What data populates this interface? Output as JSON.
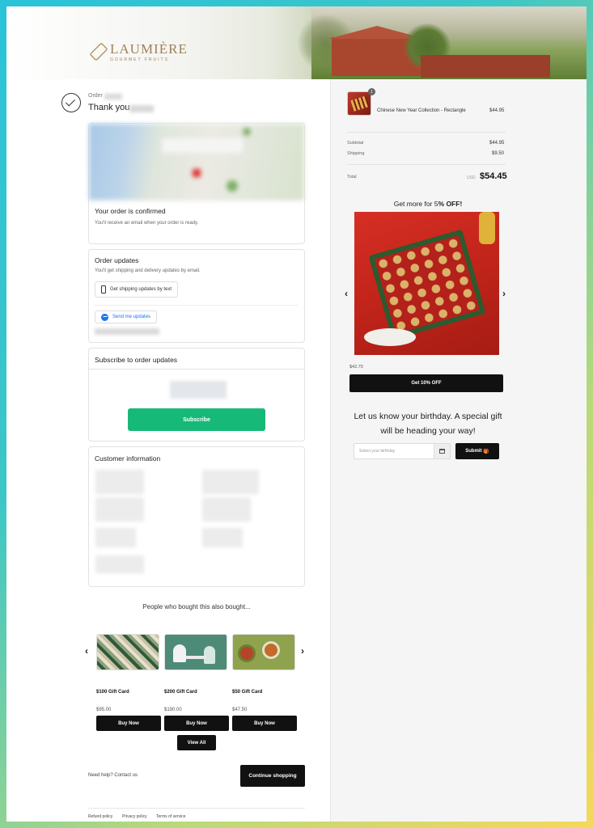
{
  "brand": {
    "name": "LAUMIÈRE",
    "tagline": "GOURMET FRUITS"
  },
  "colors": {
    "accent_green": "#17b978",
    "dark": "#111111",
    "brand_gold": "#9c8258"
  },
  "order": {
    "label": "Order",
    "thank_you": "Thank you"
  },
  "confirmed_card": {
    "title": "Your order is confirmed",
    "subtitle": "You'll receive an email when your order is ready."
  },
  "updates_card": {
    "title": "Order updates",
    "subtitle": "You'll get shipping and delivery updates by email.",
    "text_button": "Get shipping updates by text",
    "messenger_button": "Send me updates"
  },
  "subscribe_card": {
    "title": "Subscribe to order updates",
    "button": "Subscribe"
  },
  "customer_card": {
    "title": "Customer information"
  },
  "recommendations": {
    "title": "People who bought this also bought...",
    "items": [
      {
        "name": "$100 Gift Card",
        "price": "$95.00",
        "button": "Buy Now"
      },
      {
        "name": "$200 Gift Card",
        "price": "$190.00",
        "button": "Buy Now"
      },
      {
        "name": "$50 Gift Card",
        "price": "$47.50",
        "button": "Buy Now"
      }
    ],
    "view_all": "View All"
  },
  "footer": {
    "need_help": "Need help? Contact us",
    "continue": "Continue shopping",
    "links": [
      "Refund policy",
      "Privacy policy",
      "Terms of service"
    ]
  },
  "summary": {
    "quantity": "1",
    "item_name": "Chinese New Year Collection - Rectangle",
    "item_price": "$44.95",
    "subtotal_label": "Subtotal",
    "subtotal": "$44.95",
    "shipping_label": "Shipping",
    "shipping": "$9.50",
    "total_label": "Total",
    "currency": "USD",
    "total": "$54.45"
  },
  "promo": {
    "title_prefix": "Get more for 5",
    "title_bold": "% OFF!",
    "price": "$42.70",
    "button": "Get 10% OFF"
  },
  "birthday": {
    "title": "Let us know your birthday. A special gift will be heading your way!",
    "placeholder": "Select your birthday",
    "submit": "Submit",
    "submit_icon": "🎁"
  }
}
